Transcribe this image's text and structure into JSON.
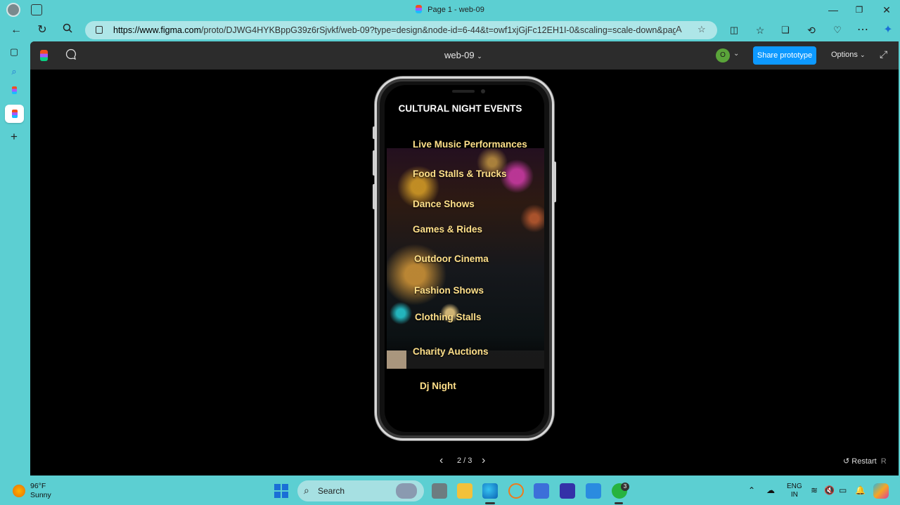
{
  "browser": {
    "tab_title": "Page 1 - web-09",
    "url_host": "https://www.figma.com",
    "url_rest": "/proto/DJWG4HYKBppG39z6rSjvkf/web-09?type=design&node-id=6-44&t=owf1xjGjFc12EH1I-0&scaling=scale-down&page-id...",
    "minimize": "—",
    "maximize": "❐",
    "close": "✕"
  },
  "figma": {
    "file_name": "web-09",
    "user_initial": "O",
    "share_label": "Share prototype",
    "options_label": "Options",
    "page_indicator": "2 / 3",
    "restart_label": "Restart",
    "restart_key": "R"
  },
  "prototype": {
    "title": "CULTURAL NIGHT EVENTS",
    "items": [
      "Live Music Performances",
      "Food Stalls & Trucks",
      "Dance Shows",
      "Games & Rides",
      "Outdoor  Cinema",
      "Fashion Shows",
      "Clothing Stalls",
      "Charity Auctions",
      "Dj Night"
    ]
  },
  "taskbar": {
    "temperature": "96°F",
    "condition": "Sunny",
    "search_label": "Search",
    "whatsapp_badge": "3",
    "lang_1": "ENG",
    "lang_2": "IN"
  },
  "colors": {
    "accent": "#0d99ff",
    "menu_text": "#ffe08a",
    "chrome_bg": "#5ccfd2"
  }
}
